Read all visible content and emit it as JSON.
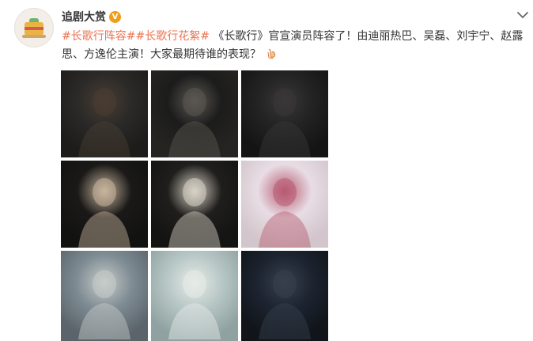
{
  "post": {
    "author": "追剧大赏",
    "verified_badge": "V",
    "menu_icon": "chevron-down-icon",
    "content": {
      "hashtag1": "#长歌行阵容#",
      "hashtag2": "#长歌行花絮#",
      "text": " 《长歌行》官宣演员阵容了！由迪丽热巴、吴磊、刘宇宁、赵露思、方逸伦主演！大家最期待谁的表现？",
      "emoji": "hand-emoji-icon"
    },
    "images": [
      {
        "name": "photo-1",
        "colors": [
          "#2b2a28",
          "#4a3d33",
          "#1d1c1a"
        ]
      },
      {
        "name": "photo-2",
        "colors": [
          "#1c1c1c",
          "#5b5852",
          "#262421"
        ]
      },
      {
        "name": "photo-3",
        "colors": [
          "#232324",
          "#3a3738",
          "#141414"
        ]
      },
      {
        "name": "photo-4",
        "colors": [
          "#1a1918",
          "#c8b59d",
          "#121211"
        ]
      },
      {
        "name": "photo-5",
        "colors": [
          "#1f1e1c",
          "#d9d3c7",
          "#141413"
        ]
      },
      {
        "name": "photo-6",
        "colors": [
          "#e8dde4",
          "#b85a72",
          "#d2c5cb"
        ]
      },
      {
        "name": "photo-7",
        "colors": [
          "#7f8c94",
          "#c7ccc9",
          "#5b646b"
        ]
      },
      {
        "name": "photo-8",
        "colors": [
          "#b7c7c5",
          "#e7ebe8",
          "#8fa2a1"
        ]
      },
      {
        "name": "photo-9",
        "colors": [
          "#1c2430",
          "#38404d",
          "#111419"
        ]
      }
    ]
  }
}
